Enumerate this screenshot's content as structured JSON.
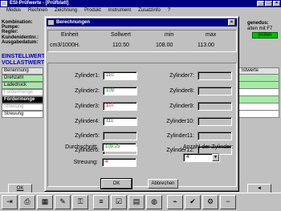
{
  "app": {
    "title": "ESI-Prüfwerte - [Prüfblatt]",
    "menu": [
      "Modus",
      "Rechnen",
      "Zeichnung",
      "Produkt",
      "Instrument",
      "Zusatzinfo",
      "?"
    ]
  },
  "info_labels": [
    "Kombination:",
    "Pumpe:",
    "Regler:",
    "Kundenidentnr.:",
    "Ausgabedatum:"
  ],
  "right_header": {
    "title": "genedus:",
    "sub": "alten mit F7",
    "button": "prüfen"
  },
  "einstell": {
    "line1": "EINSTELLWERTE",
    "line2": "VOLLASTWERTE"
  },
  "side_list": [
    {
      "label": "Benennung",
      "style": "hdr"
    },
    {
      "label": "Drehzahl",
      "style": "green"
    },
    {
      "label": "Ladedruck",
      "style": "green"
    },
    {
      "label": "Fördermenge",
      "style": "dim"
    },
    {
      "label": "Fördermenge",
      "style": "sel"
    },
    {
      "label": "Streuung",
      "style": "dim"
    },
    {
      "label": "Streuung",
      "style": "plain"
    }
  ],
  "istwerte": {
    "header": "Istwerte"
  },
  "main_buttons": {
    "ok": "OK"
  },
  "dialog": {
    "title": "Berechnungen",
    "close": "×",
    "units": {
      "h_einheit": "Einheit",
      "h_sollwert": "Sollwert",
      "h_min": "min",
      "h_max": "max",
      "unit": "cm3/1000H.",
      "sollwert": "110.50",
      "min": "108.00",
      "max": "113.00"
    },
    "cylinders_left": [
      {
        "label": "Zylinder1:",
        "value": "110",
        "state": "green"
      },
      {
        "label": "Zylinder2:",
        "value": "109",
        "state": "green"
      },
      {
        "label": "Zylinder3:",
        "value": "107",
        "state": "red"
      },
      {
        "label": "Zylinder4:",
        "value": "111",
        "state": "green"
      },
      {
        "label": "Zylinder5:",
        "value": "",
        "state": "dis"
      },
      {
        "label": "Zylinder6:",
        "value": "",
        "state": "dis"
      }
    ],
    "cylinders_right": [
      {
        "label": "Zylinder7:",
        "value": "",
        "state": "dis"
      },
      {
        "label": "Zylinder8:",
        "value": "",
        "state": "dis"
      },
      {
        "label": "Zylinder9:",
        "value": "",
        "state": "dis"
      },
      {
        "label": "Zylinder10:",
        "value": "",
        "state": "dis"
      },
      {
        "label": "Zylinder11:",
        "value": "",
        "state": "dis"
      },
      {
        "label": "Zylinder12:",
        "value": "",
        "state": "dis"
      }
    ],
    "durchschnitt_label": "Durchschnitt:",
    "durchschnitt_value": "109.25",
    "streuung_label": "Streuung:",
    "streuung_value": "4",
    "anzahl_label": "Anzahl der Zylinder:",
    "anzahl_value": "4",
    "ok_label": "OK",
    "cancel_label": "Abbrechen"
  },
  "toolbar_icons": [
    "exit-icon",
    "print-icon",
    "calc-icon",
    "tools-icon",
    "lock-icon",
    "list-icon",
    "ok-icon",
    "db-icon",
    "pump-icon",
    "graph-icon",
    "check-icon",
    "gear-icon",
    "minus-icon"
  ],
  "colors": {
    "title_bar": "#000080",
    "desktop": "#008080",
    "ok_green": "#008000",
    "fail_red": "#d00000",
    "highlight_green": "#a8e8a8"
  }
}
